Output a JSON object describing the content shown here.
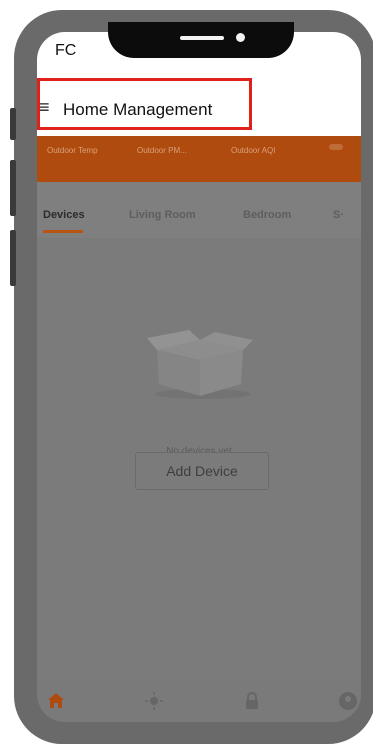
{
  "status_bar": {
    "text": "FC"
  },
  "header": {
    "menu_glyph": "≡",
    "title": "Home Management"
  },
  "env_strip": {
    "labels": [
      "Outdoor Temp",
      "Outdoor PM...",
      "Outdoor AQI"
    ]
  },
  "tabs": [
    {
      "label": "Devices",
      "active": true
    },
    {
      "label": "Living Room",
      "active": false
    },
    {
      "label": "Bedroom",
      "active": false
    },
    {
      "label": "S·",
      "active": false
    }
  ],
  "empty_state": {
    "message": "No devices yet",
    "button_label": "Add Device"
  },
  "bottom_nav": {
    "items": [
      {
        "icon": "home-icon"
      },
      {
        "icon": "sun-icon"
      },
      {
        "icon": "lock-icon"
      },
      {
        "icon": "profile-icon"
      }
    ]
  },
  "colors": {
    "highlight": "#e0201b",
    "accent": "#b04b0f",
    "dim_overlay": "#7b7b7b"
  }
}
